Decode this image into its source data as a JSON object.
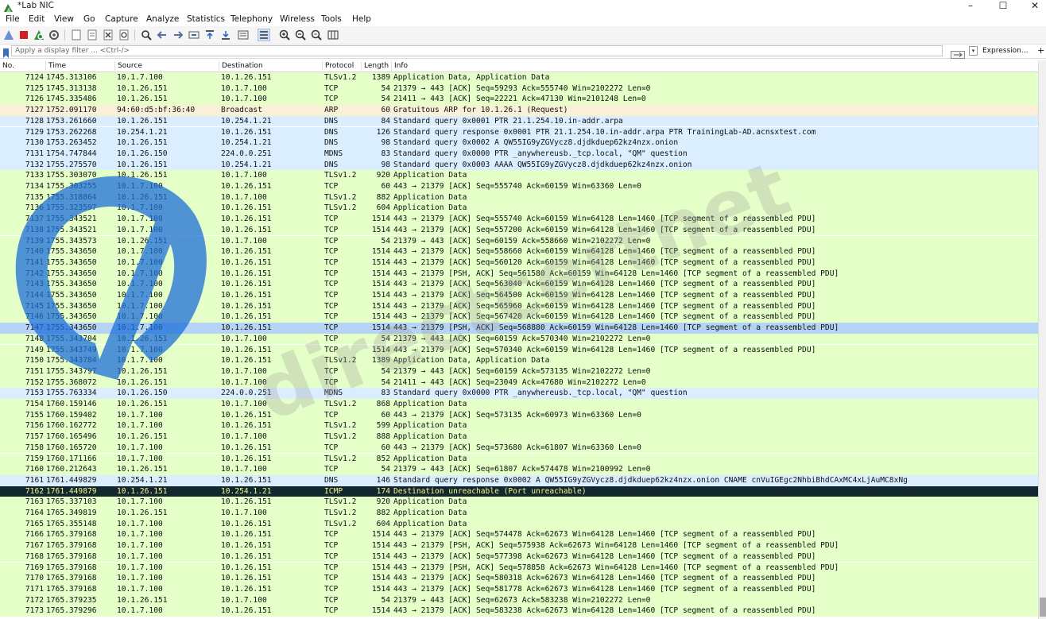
{
  "window": {
    "title": "*Lab NIC",
    "controls": {
      "minimize": "–",
      "maximize": "☐",
      "close": "✕"
    }
  },
  "menu": [
    "File",
    "Edit",
    "View",
    "Go",
    "Capture",
    "Analyze",
    "Statistics",
    "Telephony",
    "Wireless",
    "Tools",
    "Help"
  ],
  "toolbar": {
    "icons": [
      "shark-fin-start-icon",
      "stop-capture-icon",
      "restart-capture-icon",
      "capture-options-icon",
      "open-file-icon",
      "save-file-icon",
      "close-file-icon",
      "reload-file-icon",
      "find-packet-icon",
      "go-back-icon",
      "go-forward-icon",
      "go-to-packet-icon",
      "go-first-icon",
      "go-last-icon",
      "autoscroll-icon",
      "colorize-icon",
      "zoom-in-icon",
      "zoom-out-icon",
      "zoom-normal-icon",
      "resize-columns-icon"
    ]
  },
  "filter": {
    "placeholder": "Apply a display filter ... <Ctrl-/>",
    "expression_label": "Expression...",
    "plus_label": "+"
  },
  "columns": [
    "No.",
    "Time",
    "Source",
    "Destination",
    "Protocol",
    "Length",
    "Info"
  ],
  "colors": {
    "tcp": "#e4ffc7",
    "dns": "#daeeff",
    "arp": "#faf0d7",
    "icmp": "#12272e",
    "selected": "#b5d3f5",
    "watermark": "#1e6fd9"
  },
  "watermark_text": "directcertnet",
  "selected_no": "7147",
  "packets": [
    {
      "no": "7124",
      "time": "1745.313106",
      "src": "10.1.7.100",
      "dst": "10.1.26.151",
      "proto": "TLSv1.2",
      "len": "1389",
      "info": "Application Data, Application Data"
    },
    {
      "no": "7125",
      "time": "1745.313138",
      "src": "10.1.26.151",
      "dst": "10.1.7.100",
      "proto": "TCP",
      "len": "54",
      "info": "21379 → 443 [ACK] Seq=59293 Ack=555740 Win=2102272 Len=0"
    },
    {
      "no": "7126",
      "time": "1745.335486",
      "src": "10.1.26.151",
      "dst": "10.1.7.100",
      "proto": "TCP",
      "len": "54",
      "info": "21411 → 443 [ACK] Seq=22221 Ack=47130 Win=2101248 Len=0"
    },
    {
      "no": "7127",
      "time": "1752.091170",
      "src": "94:60:d5:bf:36:40",
      "dst": "Broadcast",
      "proto": "ARP",
      "len": "60",
      "info": "Gratuitous ARP for 10.1.26.1 (Request)"
    },
    {
      "no": "7128",
      "time": "1753.261660",
      "src": "10.1.26.151",
      "dst": "10.254.1.21",
      "proto": "DNS",
      "len": "84",
      "info": "Standard query 0x0001 PTR 21.1.254.10.in-addr.arpa"
    },
    {
      "no": "7129",
      "time": "1753.262268",
      "src": "10.254.1.21",
      "dst": "10.1.26.151",
      "proto": "DNS",
      "len": "126",
      "info": "Standard query response 0x0001 PTR 21.1.254.10.in-addr.arpa PTR TrainingLab-AD.acnsxtest.com"
    },
    {
      "no": "7130",
      "time": "1753.263452",
      "src": "10.1.26.151",
      "dst": "10.254.1.21",
      "proto": "DNS",
      "len": "98",
      "info": "Standard query 0x0002 A QW55IG9yZGVycz8.djdkduep62kz4nzx.onion"
    },
    {
      "no": "7131",
      "time": "1754.747844",
      "src": "10.1.26.150",
      "dst": "224.0.0.251",
      "proto": "MDNS",
      "len": "83",
      "info": "Standard query 0x0000 PTR _anywhereusb._tcp.local, \"QM\" question"
    },
    {
      "no": "7132",
      "time": "1755.275570",
      "src": "10.1.26.151",
      "dst": "10.254.1.21",
      "proto": "DNS",
      "len": "98",
      "info": "Standard query 0x0003 AAAA QW55IG9yZGVycz8.djdkduep62kz4nzx.onion"
    },
    {
      "no": "7133",
      "time": "1755.303070",
      "src": "10.1.26.151",
      "dst": "10.1.7.100",
      "proto": "TLSv1.2",
      "len": "920",
      "info": "Application Data"
    },
    {
      "no": "7134",
      "time": "1755.303255",
      "src": "10.1.7.100",
      "dst": "10.1.26.151",
      "proto": "TCP",
      "len": "60",
      "info": "443 → 21379 [ACK] Seq=555740 Ack=60159 Win=63360 Len=0"
    },
    {
      "no": "7135",
      "time": "1755.318864",
      "src": "10.1.26.151",
      "dst": "10.1.7.100",
      "proto": "TLSv1.2",
      "len": "882",
      "info": "Application Data"
    },
    {
      "no": "7136",
      "time": "1755.323597",
      "src": "10.1.7.100",
      "dst": "10.1.26.151",
      "proto": "TLSv1.2",
      "len": "604",
      "info": "Application Data"
    },
    {
      "no": "7137",
      "time": "1755.343521",
      "src": "10.1.7.100",
      "dst": "10.1.26.151",
      "proto": "TCP",
      "len": "1514",
      "info": "443 → 21379 [ACK] Seq=555740 Ack=60159 Win=64128 Len=1460 [TCP segment of a reassembled PDU]"
    },
    {
      "no": "7138",
      "time": "1755.343521",
      "src": "10.1.7.100",
      "dst": "10.1.26.151",
      "proto": "TCP",
      "len": "1514",
      "info": "443 → 21379 [ACK] Seq=557200 Ack=60159 Win=64128 Len=1460 [TCP segment of a reassembled PDU]"
    },
    {
      "no": "7139",
      "time": "1755.343573",
      "src": "10.1.26.151",
      "dst": "10.1.7.100",
      "proto": "TCP",
      "len": "54",
      "info": "21379 → 443 [ACK] Seq=60159 Ack=558660 Win=2102272 Len=0"
    },
    {
      "no": "7140",
      "time": "1755.343650",
      "src": "10.1.7.100",
      "dst": "10.1.26.151",
      "proto": "TCP",
      "len": "1514",
      "info": "443 → 21379 [ACK] Seq=558660 Ack=60159 Win=64128 Len=1460 [TCP segment of a reassembled PDU]"
    },
    {
      "no": "7141",
      "time": "1755.343650",
      "src": "10.1.7.100",
      "dst": "10.1.26.151",
      "proto": "TCP",
      "len": "1514",
      "info": "443 → 21379 [ACK] Seq=560120 Ack=60159 Win=64128 Len=1460 [TCP segment of a reassembled PDU]"
    },
    {
      "no": "7142",
      "time": "1755.343650",
      "src": "10.1.7.100",
      "dst": "10.1.26.151",
      "proto": "TCP",
      "len": "1514",
      "info": "443 → 21379 [PSH, ACK] Seq=561580 Ack=60159 Win=64128 Len=1460 [TCP segment of a reassembled PDU]"
    },
    {
      "no": "7143",
      "time": "1755.343650",
      "src": "10.1.7.100",
      "dst": "10.1.26.151",
      "proto": "TCP",
      "len": "1514",
      "info": "443 → 21379 [ACK] Seq=563040 Ack=60159 Win=64128 Len=1460 [TCP segment of a reassembled PDU]"
    },
    {
      "no": "7144",
      "time": "1755.343650",
      "src": "10.1.7.100",
      "dst": "10.1.26.151",
      "proto": "TCP",
      "len": "1514",
      "info": "443 → 21379 [ACK] Seq=564500 Ack=60159 Win=64128 Len=1460 [TCP segment of a reassembled PDU]"
    },
    {
      "no": "7145",
      "time": "1755.343650",
      "src": "10.1.7.100",
      "dst": "10.1.26.151",
      "proto": "TCP",
      "len": "1514",
      "info": "443 → 21379 [ACK] Seq=565960 Ack=60159 Win=64128 Len=1460 [TCP segment of a reassembled PDU]"
    },
    {
      "no": "7146",
      "time": "1755.343650",
      "src": "10.1.7.100",
      "dst": "10.1.26.151",
      "proto": "TCP",
      "len": "1514",
      "info": "443 → 21379 [ACK] Seq=567420 Ack=60159 Win=64128 Len=1460 [TCP segment of a reassembled PDU]"
    },
    {
      "no": "7147",
      "time": "1755.343650",
      "src": "10.1.7.100",
      "dst": "10.1.26.151",
      "proto": "TCP",
      "len": "1514",
      "info": "443 → 21379 [PSH, ACK] Seq=568880 Ack=60159 Win=64128 Len=1460 [TCP segment of a reassembled PDU]"
    },
    {
      "no": "7148",
      "time": "1755.343704",
      "src": "10.1.26.151",
      "dst": "10.1.7.100",
      "proto": "TCP",
      "len": "54",
      "info": "21379 → 443 [ACK] Seq=60159 Ack=570340 Win=2102272 Len=0"
    },
    {
      "no": "7149",
      "time": "1755.343749",
      "src": "10.1.7.100",
      "dst": "10.1.26.151",
      "proto": "TCP",
      "len": "1514",
      "info": "443 → 21379 [ACK] Seq=570340 Ack=60159 Win=64128 Len=1460 [TCP segment of a reassembled PDU]"
    },
    {
      "no": "7150",
      "time": "1755.343784",
      "src": "10.1.7.100",
      "dst": "10.1.26.151",
      "proto": "TLSv1.2",
      "len": "1389",
      "info": "Application Data, Application Data"
    },
    {
      "no": "7151",
      "time": "1755.343797",
      "src": "10.1.26.151",
      "dst": "10.1.7.100",
      "proto": "TCP",
      "len": "54",
      "info": "21379 → 443 [ACK] Seq=60159 Ack=573135 Win=2102272 Len=0"
    },
    {
      "no": "7152",
      "time": "1755.368072",
      "src": "10.1.26.151",
      "dst": "10.1.7.100",
      "proto": "TCP",
      "len": "54",
      "info": "21411 → 443 [ACK] Seq=23049 Ack=47680 Win=2102272 Len=0"
    },
    {
      "no": "7153",
      "time": "1755.763334",
      "src": "10.1.26.150",
      "dst": "224.0.0.251",
      "proto": "MDNS",
      "len": "83",
      "info": "Standard query 0x0000 PTR _anywhereusb._tcp.local, \"QM\" question"
    },
    {
      "no": "7154",
      "time": "1760.159146",
      "src": "10.1.26.151",
      "dst": "10.1.7.100",
      "proto": "TLSv1.2",
      "len": "868",
      "info": "Application Data"
    },
    {
      "no": "7155",
      "time": "1760.159402",
      "src": "10.1.7.100",
      "dst": "10.1.26.151",
      "proto": "TCP",
      "len": "60",
      "info": "443 → 21379 [ACK] Seq=573135 Ack=60973 Win=63360 Len=0"
    },
    {
      "no": "7156",
      "time": "1760.162772",
      "src": "10.1.7.100",
      "dst": "10.1.26.151",
      "proto": "TLSv1.2",
      "len": "599",
      "info": "Application Data"
    },
    {
      "no": "7157",
      "time": "1760.165496",
      "src": "10.1.26.151",
      "dst": "10.1.7.100",
      "proto": "TLSv1.2",
      "len": "888",
      "info": "Application Data"
    },
    {
      "no": "7158",
      "time": "1760.165720",
      "src": "10.1.7.100",
      "dst": "10.1.26.151",
      "proto": "TCP",
      "len": "60",
      "info": "443 → 21379 [ACK] Seq=573680 Ack=61807 Win=63360 Len=0"
    },
    {
      "no": "7159",
      "time": "1760.171166",
      "src": "10.1.7.100",
      "dst": "10.1.26.151",
      "proto": "TLSv1.2",
      "len": "852",
      "info": "Application Data"
    },
    {
      "no": "7160",
      "time": "1760.212643",
      "src": "10.1.26.151",
      "dst": "10.1.7.100",
      "proto": "TCP",
      "len": "54",
      "info": "21379 → 443 [ACK] Seq=61807 Ack=574478 Win=2100992 Len=0"
    },
    {
      "no": "7161",
      "time": "1761.449829",
      "src": "10.254.1.21",
      "dst": "10.1.26.151",
      "proto": "DNS",
      "len": "146",
      "info": "Standard query response 0x0002 A QW55IG9yZGVycz8.djdkduep62kz4nzx.onion CNAME cnVuIGEgc2NhbiBhdCAxMC4xLjAuMC8xNg"
    },
    {
      "no": "7162",
      "time": "1761.449879",
      "src": "10.1.26.151",
      "dst": "10.254.1.21",
      "proto": "ICMP",
      "len": "174",
      "info": "Destination unreachable (Port unreachable)"
    },
    {
      "no": "7163",
      "time": "1765.337103",
      "src": "10.1.7.100",
      "dst": "10.1.26.151",
      "proto": "TLSv1.2",
      "len": "920",
      "info": "Application Data"
    },
    {
      "no": "7164",
      "time": "1765.349819",
      "src": "10.1.26.151",
      "dst": "10.1.7.100",
      "proto": "TLSv1.2",
      "len": "882",
      "info": "Application Data"
    },
    {
      "no": "7165",
      "time": "1765.355148",
      "src": "10.1.7.100",
      "dst": "10.1.26.151",
      "proto": "TLSv1.2",
      "len": "604",
      "info": "Application Data"
    },
    {
      "no": "7166",
      "time": "1765.379168",
      "src": "10.1.7.100",
      "dst": "10.1.26.151",
      "proto": "TCP",
      "len": "1514",
      "info": "443 → 21379 [ACK] Seq=574478 Ack=62673 Win=64128 Len=1460 [TCP segment of a reassembled PDU]"
    },
    {
      "no": "7167",
      "time": "1765.379168",
      "src": "10.1.7.100",
      "dst": "10.1.26.151",
      "proto": "TCP",
      "len": "1514",
      "info": "443 → 21379 [PSH, ACK] Seq=575938 Ack=62673 Win=64128 Len=1460 [TCP segment of a reassembled PDU]"
    },
    {
      "no": "7168",
      "time": "1765.379168",
      "src": "10.1.7.100",
      "dst": "10.1.26.151",
      "proto": "TCP",
      "len": "1514",
      "info": "443 → 21379 [ACK] Seq=577398 Ack=62673 Win=64128 Len=1460 [TCP segment of a reassembled PDU]"
    },
    {
      "no": "7169",
      "time": "1765.379168",
      "src": "10.1.7.100",
      "dst": "10.1.26.151",
      "proto": "TCP",
      "len": "1514",
      "info": "443 → 21379 [PSH, ACK] Seq=578858 Ack=62673 Win=64128 Len=1460 [TCP segment of a reassembled PDU]"
    },
    {
      "no": "7170",
      "time": "1765.379168",
      "src": "10.1.7.100",
      "dst": "10.1.26.151",
      "proto": "TCP",
      "len": "1514",
      "info": "443 → 21379 [ACK] Seq=580318 Ack=62673 Win=64128 Len=1460 [TCP segment of a reassembled PDU]"
    },
    {
      "no": "7171",
      "time": "1765.379168",
      "src": "10.1.7.100",
      "dst": "10.1.26.151",
      "proto": "TCP",
      "len": "1514",
      "info": "443 → 21379 [ACK] Seq=581778 Ack=62673 Win=64128 Len=1460 [TCP segment of a reassembled PDU]"
    },
    {
      "no": "7172",
      "time": "1765.379235",
      "src": "10.1.26.151",
      "dst": "10.1.7.100",
      "proto": "TCP",
      "len": "54",
      "info": "21379 → 443 [ACK] Seq=62673 Ack=583238 Win=2102272 Len=0"
    },
    {
      "no": "7173",
      "time": "1765.379296",
      "src": "10.1.7.100",
      "dst": "10.1.26.151",
      "proto": "TCP",
      "len": "1514",
      "info": "443 → 21379 [ACK] Seq=583238 Ack=62673 Win=64128 Len=1460 [TCP segment of a reassembled PDU]"
    }
  ]
}
